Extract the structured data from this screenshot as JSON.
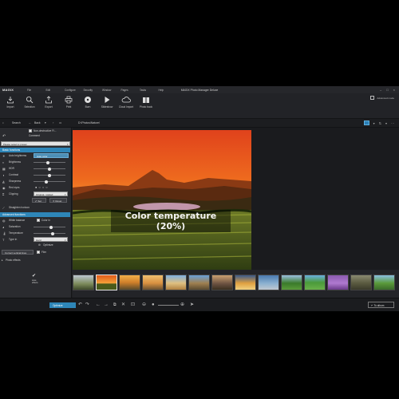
{
  "app": {
    "logo": "MAGIX",
    "title": "MAGIX Photo Manager Deluxe",
    "menu": [
      "File",
      "Edit",
      "Configure",
      "Security",
      "Window",
      "Pages",
      "Tasks",
      "Help"
    ],
    "advanced_mode": "Advanced mode"
  },
  "toolbar": [
    {
      "label": "Import",
      "icon": "import-icon"
    },
    {
      "label": "Selection",
      "icon": "search-icon"
    },
    {
      "label": "Export",
      "icon": "export-icon"
    },
    {
      "label": "Print",
      "icon": "print-icon"
    },
    {
      "label": "Burn",
      "icon": "disc-icon"
    },
    {
      "label": "Slideshow",
      "icon": "play-icon"
    },
    {
      "label": "Cloud Import",
      "icon": "cloud-icon"
    },
    {
      "label": "Photo book",
      "icon": "book-icon"
    }
  ],
  "nav": {
    "search": "Search",
    "back": "Back",
    "path": "D:\\Photos\\Nature\\"
  },
  "panel": {
    "nonstructive_label": "Non-destructive Fi...",
    "comment": "Comment",
    "preset": "Please select a preset",
    "basic_header": "Basic functions",
    "auto_brightness": "Auto brightness",
    "auto_color": "Auto color",
    "brightness": "Brightness",
    "hdr": "HDR",
    "contrast": "Contrast",
    "sharpness": "Sharpness",
    "red_eyes": "Red eyes",
    "clipping": "Clipping",
    "clipping_value": "Original, rotated",
    "set": "Set",
    "reset": "Reset",
    "straighten": "Straighten horizon",
    "advanced_header": "Advanced functions",
    "white_balance": "White balance",
    "color_in": "Color in",
    "saturation": "Saturation",
    "temperature": "Temperature",
    "type_in": "Type in",
    "type_value": "Hard",
    "optimize": "Optimize",
    "correct_vertical": "Correct vertical lines",
    "film": "Film",
    "photo_effects": "Photo effects",
    "save_label": "save",
    "save_label2": "effects"
  },
  "levels": {
    "brightness": 0.45,
    "hdr": 0.5,
    "contrast": 0.5,
    "sharpness": 0.4,
    "saturation": 0.55,
    "temperature": 0.6
  },
  "viewer": {
    "overlay": "Color temperature (20%)"
  },
  "bottom": {
    "optimize": "Optimize",
    "to_album": "To album"
  },
  "colors": {
    "accent": "#2e86b8",
    "panel": "#2a2b2f",
    "background": "#1f2023"
  }
}
